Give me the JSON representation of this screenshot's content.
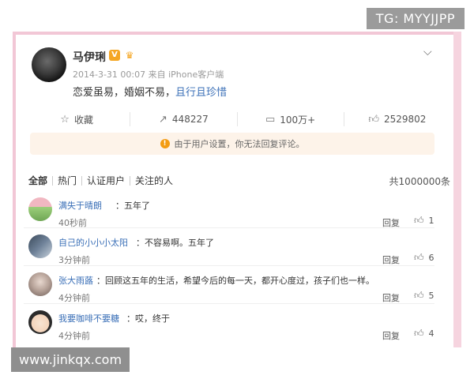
{
  "watermarks": {
    "top": "TG: MYYJJPP",
    "bottom": "www.jinkqx.com"
  },
  "post": {
    "username": "马伊琍",
    "vip_badge": "V",
    "meta": "2014-3-31 00:07 来自 iPhone客户端",
    "text": "恋爱虽易，婚姻不易，",
    "text_link": "且行且珍惜",
    "chevron_icon": "chevron-down-icon"
  },
  "actions": {
    "favorite": {
      "label": "收藏",
      "icon": "star-icon"
    },
    "repost": {
      "count": "448227",
      "icon": "repost-icon"
    },
    "comment": {
      "count": "100万+",
      "icon": "comment-icon"
    },
    "like": {
      "count": "2529802",
      "icon": "thumbs-up-icon"
    }
  },
  "notice": {
    "text": "由于用户设置，你无法回复评论。",
    "icon": "warning-icon",
    "color": "#fdf3e9"
  },
  "tabs": [
    "全部",
    "热门",
    "认证用户",
    "关注的人"
  ],
  "comment_count": "共1000000条",
  "comments": [
    {
      "name": "满失于晴朗",
      "text": "：五年了",
      "time": "40秒前",
      "reply": "回复",
      "likes": "1"
    },
    {
      "name": "自己的小小小太阳",
      "text": "：不容易啊。五年了",
      "time": "3分钟前",
      "reply": "回复",
      "likes": "6"
    },
    {
      "name": "张大雨蕗",
      "text": "：回顾这五年的生活，希望今后的每一天，都开心度过，孩子们也一样。",
      "time": "4分钟前",
      "reply": "回复",
      "likes": "5"
    },
    {
      "name": "我要咖啡不要糖",
      "text": "：哎，终于",
      "time": "4分钟前",
      "reply": "回复",
      "likes": "4"
    }
  ],
  "colors": {
    "link": "#3a6fb7",
    "frame": "#f2c7d6",
    "badge": "#f5a623"
  }
}
